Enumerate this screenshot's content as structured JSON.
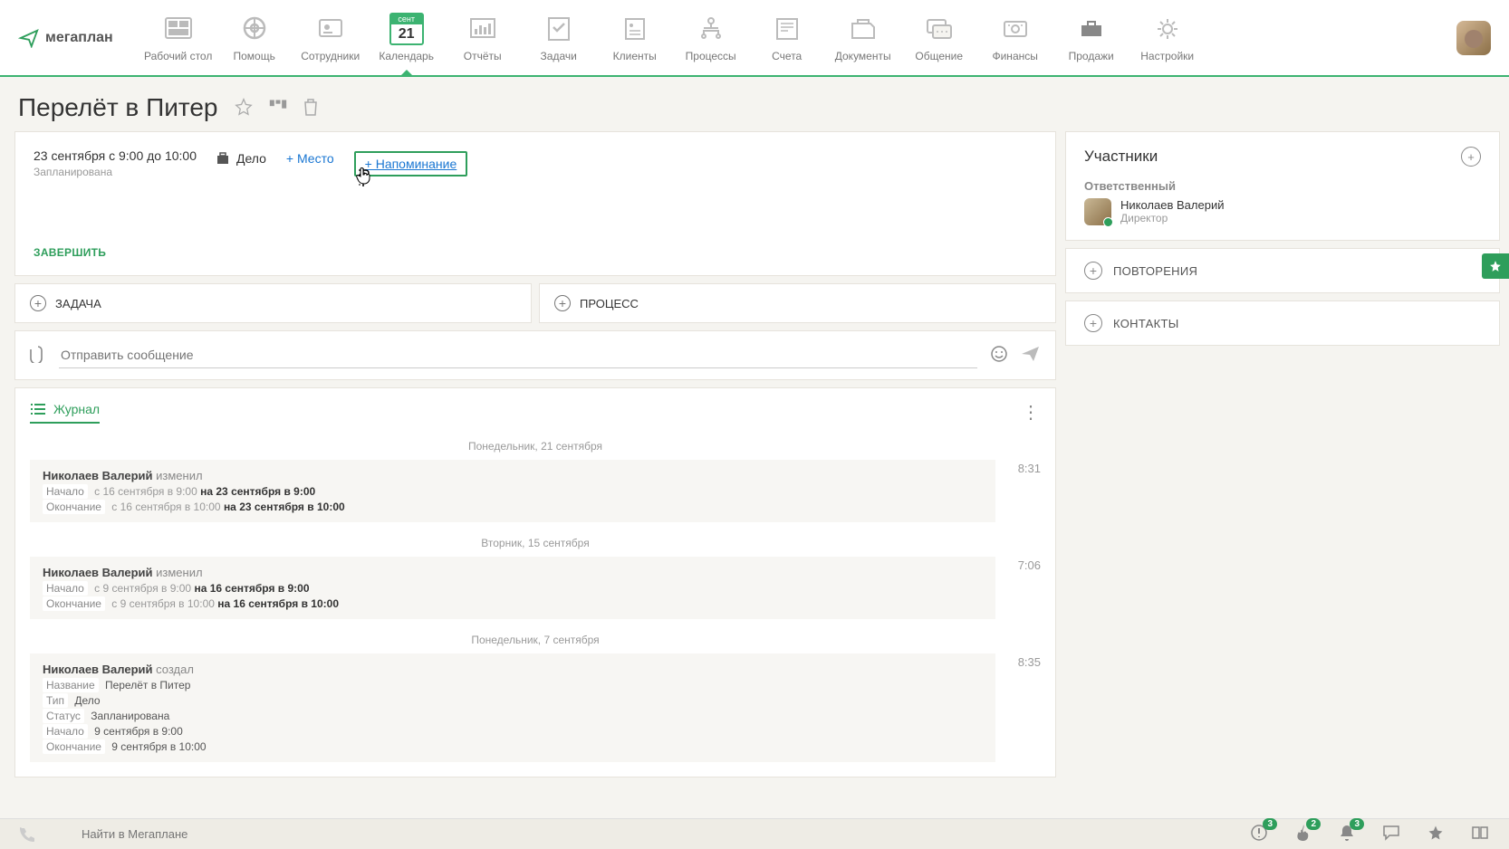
{
  "brand": "мегаплан",
  "nav": {
    "items": [
      {
        "label": "Рабочий стол"
      },
      {
        "label": "Помощь"
      },
      {
        "label": "Сотрудники"
      },
      {
        "label": "Календарь"
      },
      {
        "label": "Отчёты"
      },
      {
        "label": "Задачи"
      },
      {
        "label": "Клиенты"
      },
      {
        "label": "Процессы"
      },
      {
        "label": "Счета"
      },
      {
        "label": "Документы"
      },
      {
        "label": "Общение"
      },
      {
        "label": "Финансы"
      },
      {
        "label": "Продажи"
      },
      {
        "label": "Настройки"
      }
    ],
    "calendar_month": "сент",
    "calendar_day": "21"
  },
  "page": {
    "title": "Перелёт в Питер"
  },
  "event": {
    "time_range": "23 сентября с 9:00 до 10:00",
    "status": "Запланирована",
    "type": "Дело",
    "add_place": "+ Место",
    "add_reminder": "+ Напоминание",
    "complete_btn": "ЗАВЕРШИТЬ"
  },
  "actions": {
    "task": "ЗАДАЧА",
    "process": "ПРОЦЕСС"
  },
  "message": {
    "placeholder": "Отправить сообщение"
  },
  "journal": {
    "tab": "Журнал",
    "groups": [
      {
        "date": "Понедельник, 21 сентября",
        "entries": [
          {
            "time": "8:31",
            "author": "Николаев Валерий",
            "verb": "изменил",
            "changes": [
              {
                "field": "Начало",
                "old": "с 16 сентября в 9:00",
                "new": "на 23 сентября в 9:00"
              },
              {
                "field": "Окончание",
                "old": "с 16 сентября в 10:00",
                "new": "на 23 сентября в 10:00"
              }
            ]
          }
        ]
      },
      {
        "date": "Вторник, 15 сентября",
        "entries": [
          {
            "time": "7:06",
            "author": "Николаев Валерий",
            "verb": "изменил",
            "changes": [
              {
                "field": "Начало",
                "old": "с 9 сентября в 9:00",
                "new": "на 16 сентября в 9:00"
              },
              {
                "field": "Окончание",
                "old": "с 9 сентября в 10:00",
                "new": "на 16 сентября в 10:00"
              }
            ]
          }
        ]
      },
      {
        "date": "Понедельник, 7 сентября",
        "entries": [
          {
            "time": "8:35",
            "author": "Николаев Валерий",
            "verb": "создал",
            "changes": [
              {
                "field": "Название",
                "value": "Перелёт в Питер"
              },
              {
                "field": "Тип",
                "value": "Дело"
              },
              {
                "field": "Статус",
                "value": "Запланирована"
              },
              {
                "field": "Начало",
                "value": "9 сентября в 9:00"
              },
              {
                "field": "Окончание",
                "value": "9 сентября в 10:00"
              }
            ]
          }
        ]
      }
    ]
  },
  "sidebar": {
    "participants": {
      "title": "Участники",
      "role": "Ответственный",
      "person": {
        "name": "Николаев Валерий",
        "position": "Директор"
      }
    },
    "repeats": "ПОВТОРЕНИЯ",
    "contacts": "КОНТАКТЫ"
  },
  "bottom": {
    "search_placeholder": "Найти в Мегаплане",
    "badges": {
      "alert": "3",
      "fire": "2",
      "bell": "3"
    }
  }
}
